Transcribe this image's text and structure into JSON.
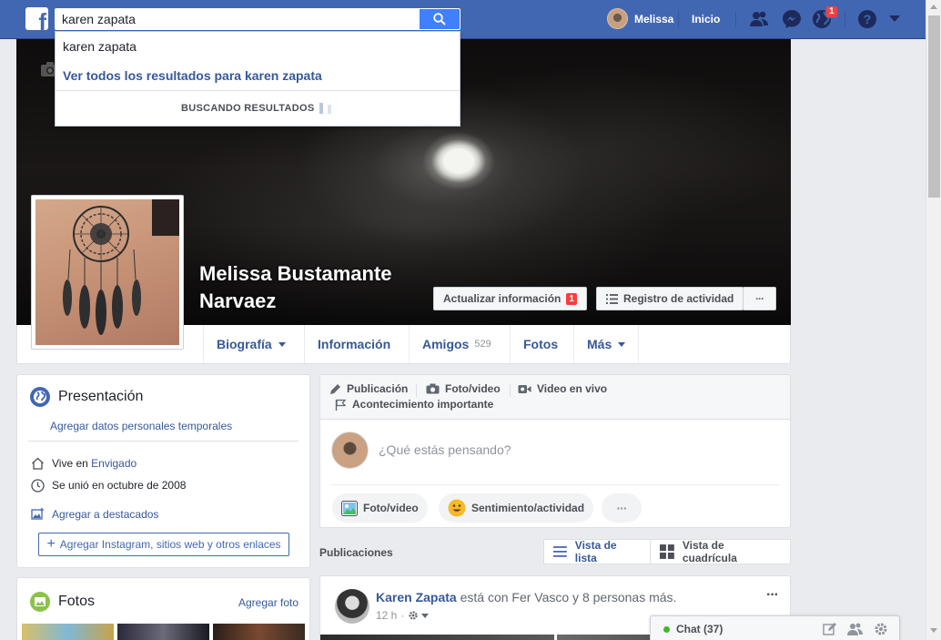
{
  "topbar": {
    "logo": "f",
    "search_value": "karen zapata",
    "user_name": "Melissa",
    "home_label": "Inicio",
    "notifications_count": "1",
    "icons": [
      "friends-icon",
      "messenger-icon",
      "globe-icon",
      "help-icon",
      "caret-down-icon"
    ]
  },
  "search_dropdown": {
    "suggestion": "karen zapata",
    "see_all": "Ver todos los resultados para karen zapata",
    "loading": "BUSCANDO RESULTADOS"
  },
  "profile": {
    "name": "Melissa Bustamante Narvaez",
    "update_info_label": "Actualizar información",
    "update_info_badge": "1",
    "activity_log_label": "Registro de actividad",
    "more_label": "···"
  },
  "tabs": [
    {
      "label": "Biografía",
      "count": ""
    },
    {
      "label": "Información",
      "count": ""
    },
    {
      "label": "Amigos",
      "count": "529"
    },
    {
      "label": "Fotos",
      "count": ""
    },
    {
      "label": "Más",
      "count": ""
    }
  ],
  "intro": {
    "title": "Presentación",
    "add_temp": "Agregar datos personales temporales",
    "lives_prefix": "Vive en ",
    "lives_place": "Envigado",
    "joined": "Se unió en octubre de 2008",
    "add_featured": "Agregar a destacados",
    "add_links": "Agregar Instagram, sitios web y otros enlaces"
  },
  "photos": {
    "title": "Fotos",
    "add_photo": "Agregar foto"
  },
  "composer": {
    "opt_post": "Publicación",
    "opt_photo": "Foto/video",
    "opt_live": "Video en vivo",
    "opt_event": "Acontecimiento importante",
    "placeholder": "¿Qué estás pensando?",
    "pill_photo": "Foto/video",
    "pill_feeling": "Sentimiento/actividad",
    "pill_more": "···"
  },
  "posts": {
    "title": "Publicaciones",
    "list_view": "Vista de lista",
    "grid_view": "Vista de cuadrícula"
  },
  "post": {
    "author": "Karen Zapata",
    "text": " está con Fer Vasco y 8 personas más.",
    "time": "12 h",
    "more": "···"
  },
  "chat": {
    "label": "Chat (37)"
  },
  "colors": {
    "brand": "#4267b2",
    "link": "#365899",
    "badge": "#fa3e3e",
    "online": "#42b72a"
  }
}
